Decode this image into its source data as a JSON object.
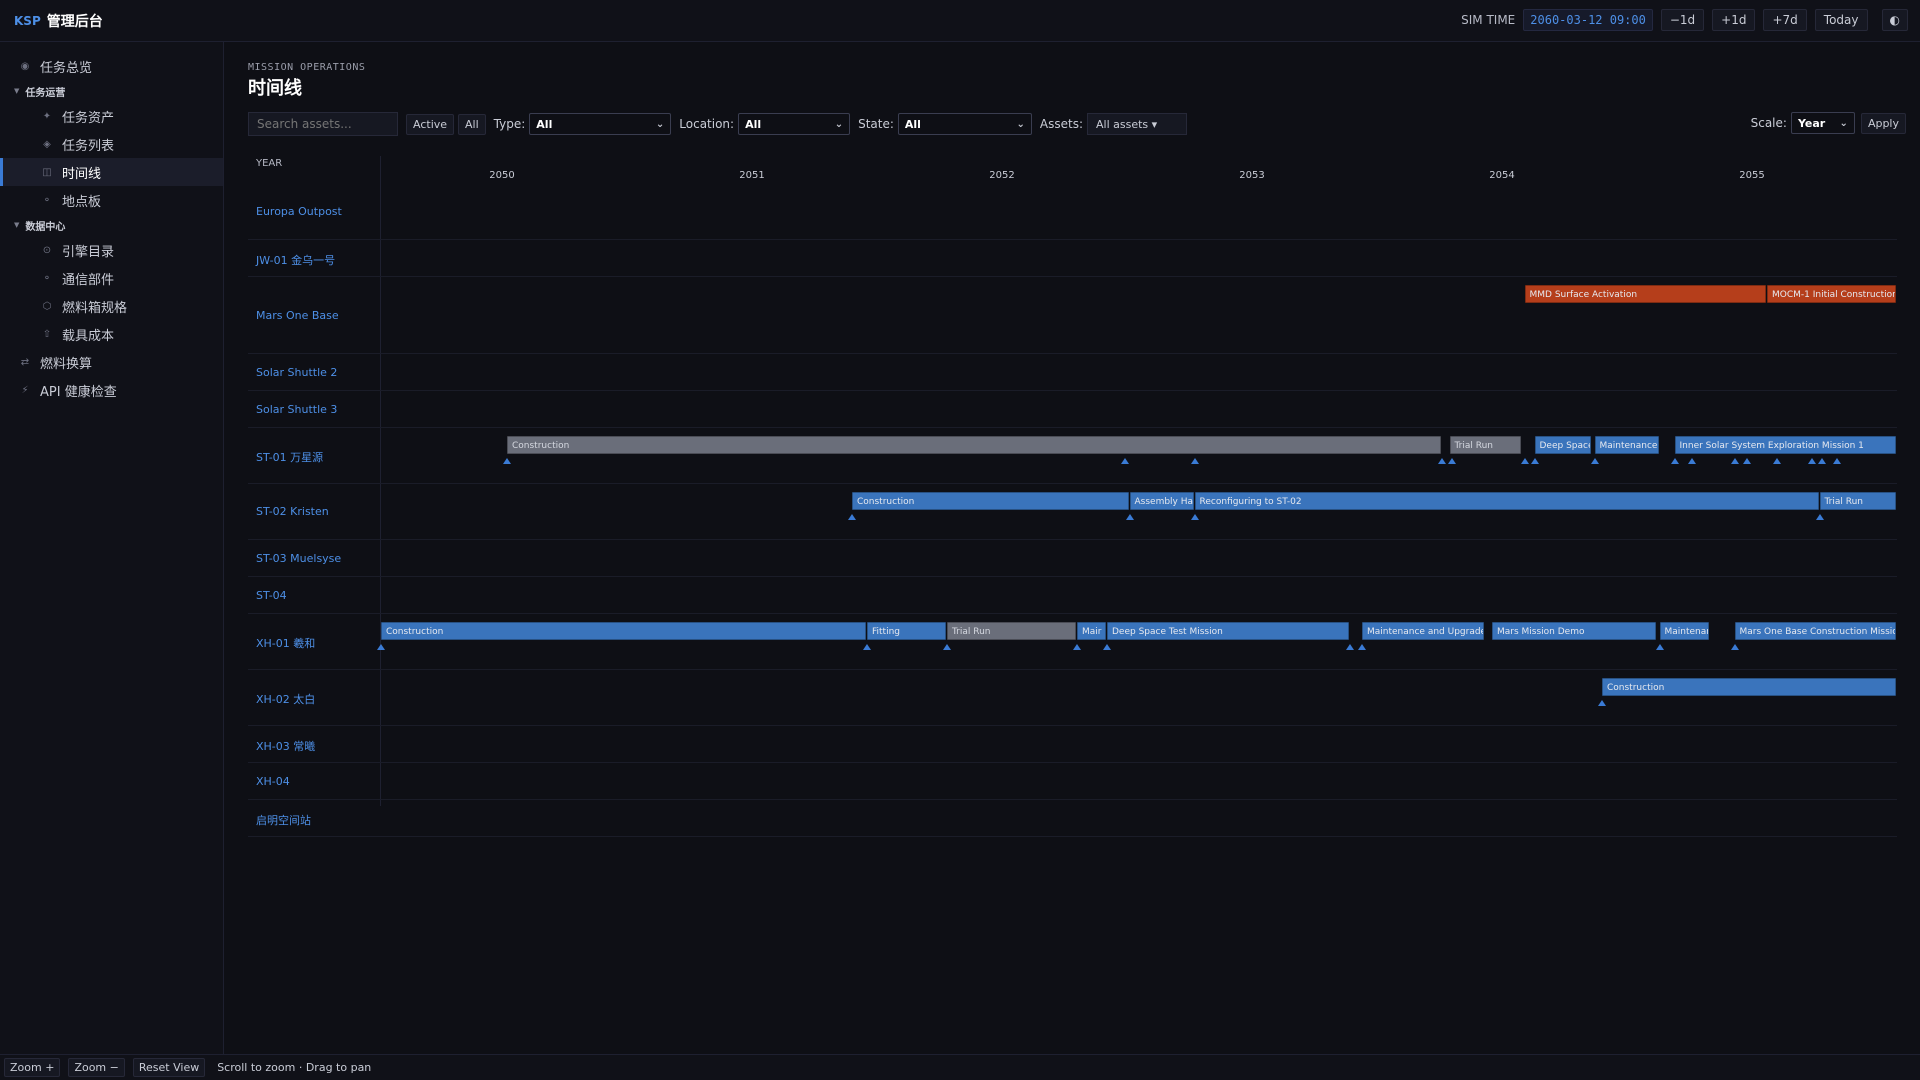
{
  "brand": {
    "short": "KSP",
    "title": "管理后台"
  },
  "topbar": {
    "sim_label": "SIM TIME",
    "sim_time": "2060-03-12 09:00",
    "buttons": [
      "−1d",
      "+1d",
      "+7d",
      "Today"
    ],
    "theme_icon": "◐"
  },
  "sidebar": {
    "overview": "任务总览",
    "section1": "任务运营",
    "section1_items": [
      "任务资产",
      "任务列表",
      "时间线",
      "地点板"
    ],
    "section2": "数据中心",
    "section2_items": [
      "引擎目录",
      "通信部件",
      "燃料箱规格",
      "载具成本"
    ],
    "fuel": "燃料换算",
    "api": "API 健康检查"
  },
  "page": {
    "eyebrow": "MISSION OPERATIONS",
    "title": "时间线"
  },
  "filters": {
    "search_placeholder": "Search assets...",
    "active": "Active",
    "all": "All",
    "type_label": "Type:",
    "type_value": "All",
    "location_label": "Location:",
    "location_value": "All",
    "state_label": "State:",
    "state_value": "All",
    "assets_label": "Assets:",
    "assets_value": "All assets ▾",
    "scale_label": "Scale:",
    "scale_value": "Year",
    "apply": "Apply"
  },
  "timeline": {
    "header_label": "YEAR",
    "years": [
      "2050",
      "2051",
      "2052",
      "2053",
      "2054",
      "2055"
    ],
    "rows": [
      {
        "label": "Europa Outpost",
        "bars": [],
        "markers": []
      },
      {
        "label": "JW-01 金乌一号",
        "bars": [],
        "markers": []
      },
      {
        "label": "Mars One Base",
        "bars": [
          {
            "text": "MMD Surface Activation",
            "start": 2054.09,
            "end": 2055.06,
            "color": "orange"
          },
          {
            "text": "MOCM-1 Initial Construction",
            "start": 2055.06,
            "end": 2055.58,
            "color": "orange"
          }
        ],
        "markers": []
      },
      {
        "label": "Solar Shuttle 2",
        "bars": [],
        "markers": []
      },
      {
        "label": "Solar Shuttle 3",
        "bars": [],
        "markers": []
      },
      {
        "label": "ST-01 万星源",
        "bars": [
          {
            "text": "Construction",
            "start": 2050.02,
            "end": 2053.76,
            "color": "gray"
          },
          {
            "text": "Trial Run",
            "start": 2053.79,
            "end": 2054.08,
            "color": "gray"
          },
          {
            "text": "Deep Space",
            "start": 2054.13,
            "end": 2054.36,
            "color": "blue"
          },
          {
            "text": "Maintenance",
            "start": 2054.37,
            "end": 2054.63,
            "color": "blue"
          },
          {
            "text": "Inner Solar System Exploration Mission 1",
            "start": 2054.69,
            "end": 2055.58,
            "color": "blue"
          }
        ],
        "markers": [
          2050.02,
          2052.49,
          2052.77,
          2053.76,
          2053.8,
          2054.09,
          2054.13,
          2054.37,
          2054.69,
          2054.76,
          2054.93,
          2054.98,
          2055.1,
          2055.24,
          2055.28,
          2055.34
        ]
      },
      {
        "label": "ST-02 Kristen",
        "bars": [
          {
            "text": "Construction",
            "start": 2051.4,
            "end": 2052.51,
            "color": "blue"
          },
          {
            "text": "Assembly Halt",
            "start": 2052.51,
            "end": 2052.77,
            "color": "blue"
          },
          {
            "text": "Reconfiguring to ST-02",
            "start": 2052.77,
            "end": 2055.27,
            "color": "blue"
          },
          {
            "text": "Trial Run",
            "start": 2055.27,
            "end": 2055.58,
            "color": "blue"
          }
        ],
        "markers": [
          2051.4,
          2052.51,
          2052.77,
          2055.27
        ]
      },
      {
        "label": "ST-03 Muelsyse",
        "bars": [],
        "markers": []
      },
      {
        "label": "ST-04",
        "bars": [],
        "markers": []
      },
      {
        "label": "XH-01 羲和",
        "bars": [
          {
            "text": "Construction",
            "start": 2049.49,
            "end": 2051.46,
            "color": "blue"
          },
          {
            "text": "Fitting",
            "start": 2051.46,
            "end": 2051.78,
            "color": "blue"
          },
          {
            "text": "Trial Run",
            "start": 2051.78,
            "end": 2052.3,
            "color": "gray"
          },
          {
            "text": "Mair",
            "start": 2052.3,
            "end": 2052.42,
            "color": "blue"
          },
          {
            "text": "Deep Space Test Mission",
            "start": 2052.42,
            "end": 2053.39,
            "color": "blue"
          },
          {
            "text": "Maintenance and Upgrade",
            "start": 2053.44,
            "end": 2053.93,
            "color": "blue"
          },
          {
            "text": "Mars Mission Demo",
            "start": 2053.96,
            "end": 2054.62,
            "color": "blue"
          },
          {
            "text": "Maintenance",
            "start": 2054.63,
            "end": 2054.83,
            "color": "blue"
          },
          {
            "text": "Mars One Base Construction Mission",
            "start": 2054.93,
            "end": 2055.58,
            "color": "blue"
          }
        ],
        "markers": [
          2049.49,
          2051.46,
          2051.78,
          2052.3,
          2052.42,
          2053.39,
          2053.44,
          2054.63,
          2054.93
        ]
      },
      {
        "label": "XH-02 太白",
        "bars": [
          {
            "text": "Construction",
            "start": 2054.4,
            "end": 2055.58,
            "color": "blue"
          }
        ],
        "markers": [
          2054.4
        ]
      },
      {
        "label": "XH-03 常曦",
        "bars": [],
        "markers": []
      },
      {
        "label": "XH-04",
        "bars": [],
        "markers": []
      },
      {
        "label": "启明空间站",
        "bars": [],
        "markers": []
      }
    ]
  },
  "bottom": {
    "zoom_in": "Zoom +",
    "zoom_out": "Zoom −",
    "reset": "Reset View",
    "hint": "Scroll to zoom · Drag to pan"
  }
}
